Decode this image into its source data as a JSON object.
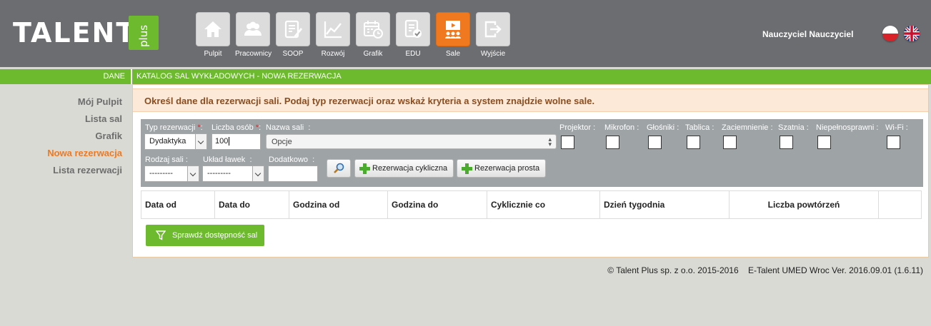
{
  "header": {
    "logo_text": "TALENT",
    "logo_plus": "plus",
    "user_name": "Nauczyciel Nauczyciel",
    "nav": [
      {
        "label": "Pulpit",
        "icon": "home-icon"
      },
      {
        "label": "Pracownicy",
        "icon": "people-icon"
      },
      {
        "label": "SOOP",
        "icon": "document-edit-icon"
      },
      {
        "label": "Rozwój",
        "icon": "chart-line-icon"
      },
      {
        "label": "Grafik",
        "icon": "calendar-clock-icon"
      },
      {
        "label": "EDU",
        "icon": "checklist-icon"
      },
      {
        "label": "Sale",
        "icon": "lecture-room-icon",
        "active": true
      },
      {
        "label": "Wyjście",
        "icon": "exit-icon"
      }
    ],
    "flags": [
      "polish-flag-icon",
      "uk-flag-icon"
    ]
  },
  "greenbar": {
    "section": "DANE",
    "breadcrumb": "KATALOG SAL WYKŁADOWYCH - NOWA REZERWACJA"
  },
  "sidebar": {
    "items": [
      {
        "label": "Mój Pulpit"
      },
      {
        "label": "Lista sal"
      },
      {
        "label": "Grafik"
      },
      {
        "label": "Nowa rezerwacja",
        "active": true
      },
      {
        "label": "Lista rezerwacji"
      }
    ]
  },
  "main": {
    "banner": "Określ dane dla rezerwacji sali. Podaj typ rezerwacji oraz wskaż kryteria a system znajdzie wolne sale.",
    "filters": {
      "typ_label": "Typ rezerwacji",
      "typ_value": "Dydaktyka",
      "osob_label": "Liczba osób",
      "osob_value": "100",
      "nazwa_label": "Nazwa sali",
      "nazwa_placeholder": "Opcje",
      "rodzaj_label": "Rodzaj sali",
      "rodzaj_value": "---------",
      "uklad_label": "Układ ławek",
      "uklad_value": "---------",
      "dodatkowo_label": "Dodatkowo",
      "dodatkowo_value": "",
      "colon": ":",
      "asterisk": "*",
      "checkboxes": [
        {
          "label": "Projektor"
        },
        {
          "label": "Mikrofon"
        },
        {
          "label": "Głośniki"
        },
        {
          "label": "Tablica"
        },
        {
          "label": "Zaciemnienie"
        },
        {
          "label": "Szatnia"
        },
        {
          "label": "Niepełnosprawni"
        },
        {
          "label": "Wi-Fi"
        }
      ],
      "btn_cykliczna": "Rezerwacja cykliczna",
      "btn_prosta": "Rezerwacja prosta"
    },
    "table": {
      "columns": [
        "Data od",
        "Data do",
        "Godzina od",
        "Godzina do",
        "Cyklicznie co",
        "Dzień tygodnia",
        "Liczba powtórzeń",
        ""
      ]
    },
    "check_button": "Sprawdź dostępność sal"
  },
  "footer": {
    "copyright": "© Talent Plus sp. z o.o. 2015-2016",
    "version": "E-Talent UMED Wroc Ver. 2016.09.01 (1.6.11)"
  },
  "colors": {
    "header_bg": "#6c6d70",
    "accent_green": "#6dba2e",
    "accent_orange": "#f0791f",
    "banner_bg": "#fde9d8",
    "filter_bg": "#9ea3a6",
    "page_bg": "#dadad5"
  }
}
